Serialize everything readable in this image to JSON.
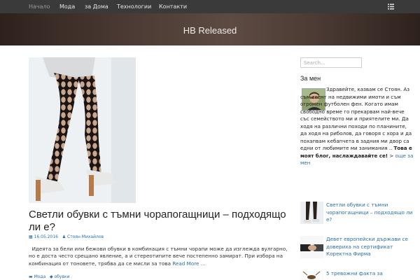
{
  "nav": {
    "items": [
      "Начало",
      "Мода",
      "за Дома",
      "Технологии",
      "Контакти"
    ]
  },
  "header": {
    "site_title": "HB Released"
  },
  "post": {
    "title": "Светли обувки с тъмни чорапогащници – подходящо ли е?",
    "date": "16.05.2016",
    "author": "Стоян Михайлов",
    "excerpt": "Идеята за бели или бежови обувки в комбинация с тъмни чорапи може да изглежда вулгарно, но е доста често срещано явление, а и стереотипите вече постепенно замират. При избора на комбинация от тоновете, трябва да се мисли за това",
    "read_more": "Read More ...",
    "tags": [
      "Мода",
      "обувки"
    ]
  },
  "sidebar": {
    "search_placeholder": "Search...",
    "about_title": "За мен",
    "about_text": "Здравейте, казвам се Стоян. Аз съм агент на недвижими имоти и съм огромен футболен фен. Когато имам свободно време го прекарвам най-вече със семейството ми и приятелите ми. Да ходя на различни походи по планините, да ходя на риболов, да говоря с хора и да похапвам кебапчета в задния ми двор са едни от любимите ми занимания ..",
    "about_bold": "Това е моят блог, наслаждавайте се!",
    "about_link": "още за мен",
    "about_link_prefix": ">",
    "recent": [
      {
        "title": "Светли обувки с тъмни чорапогащници – подходящо ли е?"
      },
      {
        "title": "Девет европейски държави се довериха на сертификат Коректна Фирма"
      },
      {
        "title": "5 тревожни факта за"
      }
    ]
  },
  "colors": {
    "link": "#2a6fa8",
    "nav_bg": "#3a3a3a",
    "banner": "#4a3a33"
  }
}
